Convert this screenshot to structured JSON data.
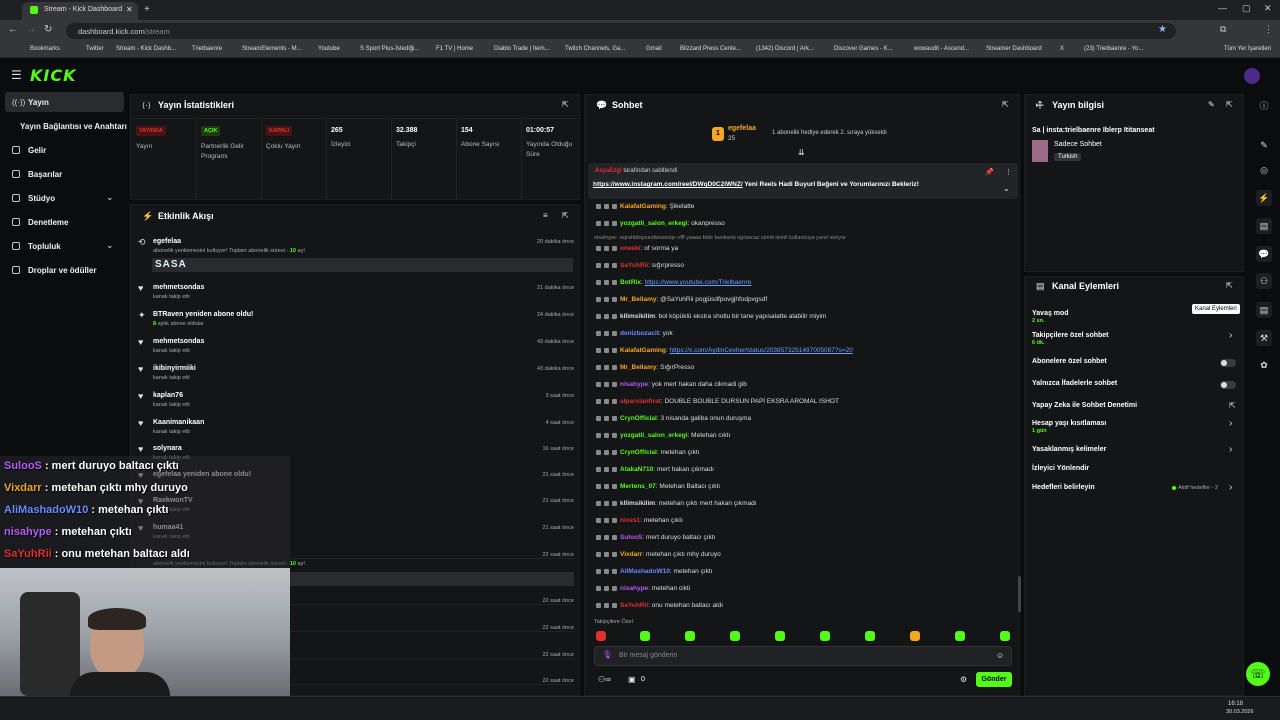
{
  "browser": {
    "tab_title": "Stream - Kick Dashboard",
    "url_host": "dashboard.kick.com",
    "url_path": "/stream",
    "bookmarks": [
      "Bookmarks",
      "Twitter",
      "Stream - Kick Dashb...",
      "Trielbaenre",
      "StreamElements - M...",
      "Youtube",
      "S Sport Plus-İstediği...",
      "F1 TV | Home",
      "Diablo Trade | Item...",
      "Twitch Channels, Ga...",
      "Gmail",
      "Blizzard Press Cente...",
      "(1342) Discord | Ark...",
      "Discover Games - K...",
      "wowaudit - Ascend...",
      "Streamer Dashboard",
      "X",
      "(23) Trielbaenre - Yo...",
      "Tüm Yer İşaretleri"
    ]
  },
  "logo": "KICK",
  "sidebar": {
    "items": [
      {
        "label": "Yayın"
      },
      {
        "label": "Yayın Bağlantısı ve Anahtarı"
      },
      {
        "label": "Gelir"
      },
      {
        "label": "Başarılar"
      },
      {
        "label": "Stüdyo"
      },
      {
        "label": "Denetleme"
      },
      {
        "label": "Topluluk"
      },
      {
        "label": "Droplar ve ödüller"
      }
    ]
  },
  "stats": {
    "title": "Yayın İstatistikleri",
    "cols": [
      {
        "badge": "YAYINDA",
        "label": "Yayın",
        "color": "#e0302f"
      },
      {
        "badge": "AÇIK",
        "label": "Partnerlik Gelir Programı",
        "color": "#53fc18"
      },
      {
        "badge": "KAPALI",
        "label": "Çoklu Yayın",
        "color": "#e0302f"
      },
      {
        "value": "265",
        "label": "İzleyici"
      },
      {
        "value": "32.388",
        "label": "Takipçi"
      },
      {
        "value": "154",
        "label": "Abone Sayısı"
      },
      {
        "value": "01:00:57",
        "label": "Yayında Olduğu Süre"
      }
    ]
  },
  "activity": {
    "title": "Etkinlik Akışı",
    "items": [
      {
        "name": "egefelaa",
        "sub_pre": "abonelik yenilemesini kutluyor! Toplam abonelik süresi - ",
        "sub_hl": "10",
        "sub_post": " ay!",
        "time": "20 dakika önce",
        "extra": "SASA"
      },
      {
        "name": "mehmetsondas",
        "sub_pre": "kanalı takip etti",
        "time": "21 dakika önce"
      },
      {
        "name": "BTRaven yeniden abone oldu!",
        "sub_hl": "8",
        "sub_post": " aylık abone oldular",
        "time": "24 dakika önce"
      },
      {
        "name": "mehmetsondas",
        "sub_pre": "kanalı takip etti",
        "time": "43 dakika önce"
      },
      {
        "name": "ikibinyirmiiki",
        "sub_pre": "kanalı takip etti",
        "time": "43 dakika önce"
      },
      {
        "name": "kaplan76",
        "sub_pre": "kanalı takip etti",
        "time": "3 saat önce"
      },
      {
        "name": "Kaanimanikaan",
        "sub_pre": "kanalı takip etti",
        "time": "4 saat önce"
      },
      {
        "name": "solynara",
        "sub_pre": "kanalı takip etti",
        "time": "16 saat önce"
      },
      {
        "name": "egefelaa yeniden abone oldu!",
        "sub_pre": "",
        "time": "21 saat önce"
      },
      {
        "name": "RaekwonTV",
        "sub_pre": "kanalı takip etti",
        "time": "21 saat önce"
      },
      {
        "name": "humaa41",
        "sub_pre": "kanalı takip etti",
        "time": "21 saat önce"
      },
      {
        "name": "",
        "sub_pre": "abonelik yenilemesini kutluyor! Toplam abonelik süresi - ",
        "sub_hl": "10",
        "sub_post": " ay!",
        "time": "22 saat önce"
      },
      {
        "name": "",
        "time": "22 saat önce"
      },
      {
        "name": "",
        "time": "22 saat önce"
      },
      {
        "name": "",
        "time": "22 saat önce"
      },
      {
        "name": "",
        "time": "22 saat önce"
      }
    ]
  },
  "chat": {
    "title": "Sohbet",
    "gift_user": "egefelaa",
    "gift_count": "25",
    "gift_text": "1 abonelik hediye ederek 2. sıraya yükseldi",
    "pinned_by": "AsyaEzgi",
    "pinned_suffix": "tarafından sabitlendi",
    "pinned_link": "https://www.instagram.com/reel/DWqD0C2iWNZ/",
    "pinned_text": " Yeni Reels Hadi Buyurl Beğeni ve Yorumlarınızı Bekleriz!",
    "reply_note": "nisahype: siqrahbbqsuudwswsiqs offf yaaaa bide bunkarla ugrascaz simdi isimli kullaniciya yanıt veriyor",
    "messages": [
      {
        "user": "KalafatGaming",
        "color": "#f5a623",
        "text": " Şikelatte"
      },
      {
        "user": "yozgatli_salon_erkegi",
        "color": "#53fc18",
        "text": " okanpresso"
      },
      {
        "user": "oneeki",
        "color": "#e0302f",
        "text": " of sorma ya"
      },
      {
        "user": "SaYuhRii",
        "color": "#e0302f",
        "text": " sığırpresso"
      },
      {
        "user": "BotRix",
        "color": "#53fc18",
        "text": " ",
        "link": "https://www.youtube.com/Trielbaenre"
      },
      {
        "user": "Mr_Bellamy",
        "color": "#f5a623",
        "text": " @SaYuhRii pogjüsdfpovgjhfodpvgsdf"
      },
      {
        "user": "kllimsikilim",
        "color": "#ddd",
        "text": " bol köpüklü ekstra shotlu bir tane yapısalatte alabilir miyim"
      },
      {
        "user": "denizbozacit",
        "color": "#6a8cff",
        "text": " yok"
      },
      {
        "user": "KalafatGaming",
        "color": "#f5a623",
        "text": " ",
        "link": "https://x.com/AydinCevher/status/2038573251497005087?s=20"
      },
      {
        "user": "Mr_Bellamy",
        "color": "#f5a623",
        "text": " SığırPresso"
      },
      {
        "user": "nisahype",
        "color": "#b45cf5",
        "text": " yok mert hakan daha cikmadi gib"
      },
      {
        "user": "alparslanfirat",
        "color": "#e0302f",
        "text": " DOUBLE BOUBLE DURSUN PAPİ EKSRA AROMAL ISHOT"
      },
      {
        "user": "CrynOfficial",
        "color": "#53fc18",
        "text": " 3 nisanda galiba onun duruşma"
      },
      {
        "user": "yozgatli_salon_erkegi",
        "color": "#53fc18",
        "text": " Metehan cıktı"
      },
      {
        "user": "CrynOfficial",
        "color": "#53fc18",
        "text": " metehan çıktı"
      },
      {
        "user": "AtakaN710",
        "color": "#53fc18",
        "text": " mert hakan çıkmadı"
      },
      {
        "user": "Mertens_07",
        "color": "#53fc18",
        "text": " Metehan Baltacı çıktı"
      },
      {
        "user": "kllimsikilim",
        "color": "#ddd",
        "text": " metehan çıktı mert hakan çıkmadı"
      },
      {
        "user": "nixes1",
        "color": "#e0302f",
        "text": " metehan çıktı"
      },
      {
        "user": "SulooS",
        "color": "#b45cf5",
        "text": " mert duruyo baltacı çıktı"
      },
      {
        "user": "Vixdarr",
        "color": "#f5a623",
        "text": " metehan çıktı mhy duruyo"
      },
      {
        "user": "AliMashadoW10",
        "color": "#6a8cff",
        "text": " metehan çıktı"
      },
      {
        "user": "nisahype",
        "color": "#b45cf5",
        "text": " metehan cikti"
      },
      {
        "user": "SaYuhRii",
        "color": "#e0302f",
        "text": " onu metehan baltacı aldı"
      }
    ],
    "mode_label": "Takipçilere Özel",
    "placeholder": "Bir mesaj gönderin",
    "send": "Gönder",
    "count": "0"
  },
  "info": {
    "title": "Yayın bilgisi",
    "stream_title": "Sa | insta:trielbaenre Iblerp Ititanseat",
    "category": "Sadece Sohbet",
    "tag": "Turkish"
  },
  "actions": {
    "title": "Kanal Eylemleri",
    "tooltip": "Kanal Eylemleri",
    "items": [
      {
        "label": "Yavaş mod",
        "sub": "2 sn."
      },
      {
        "label": "Takipçilere özel sohbet",
        "sub": "6 dk."
      },
      {
        "label": "Abonelere özel sohbet"
      },
      {
        "label": "Yalnızca İfadelerle sohbet"
      },
      {
        "label": "Yapay Zeka ile Sohbet Denetimi"
      },
      {
        "label": "Hesap yaşı kısıtlaması",
        "sub": "1 gün"
      },
      {
        "label": "Yasaklanmış kelimeler"
      },
      {
        "label": "İzleyici Yönlendir"
      },
      {
        "label": "Hedefleri belirleyin",
        "right": "Aktif hedefler - 2"
      }
    ]
  },
  "overlay": [
    {
      "user": "SulooS",
      "color": "#b45cf5",
      "text": " : mert duruyo baltacı çıktı"
    },
    {
      "user": "Vixdarr",
      "color": "#f5a623",
      "text": " : metehan çıktı mhy duruyo"
    },
    {
      "user": "AliMashadoW10",
      "color": "#6a8cff",
      "text": " : metehan çıktı"
    },
    {
      "user": "nisahype",
      "color": "#b45cf5",
      "text": " : metehan çıktı"
    },
    {
      "user": "SaYuhRii",
      "color": "#e0302f",
      "text": " : onu metehan baltacı aldı"
    }
  ],
  "taskbar": {
    "time": "16:18",
    "date": "30.03.2026"
  }
}
